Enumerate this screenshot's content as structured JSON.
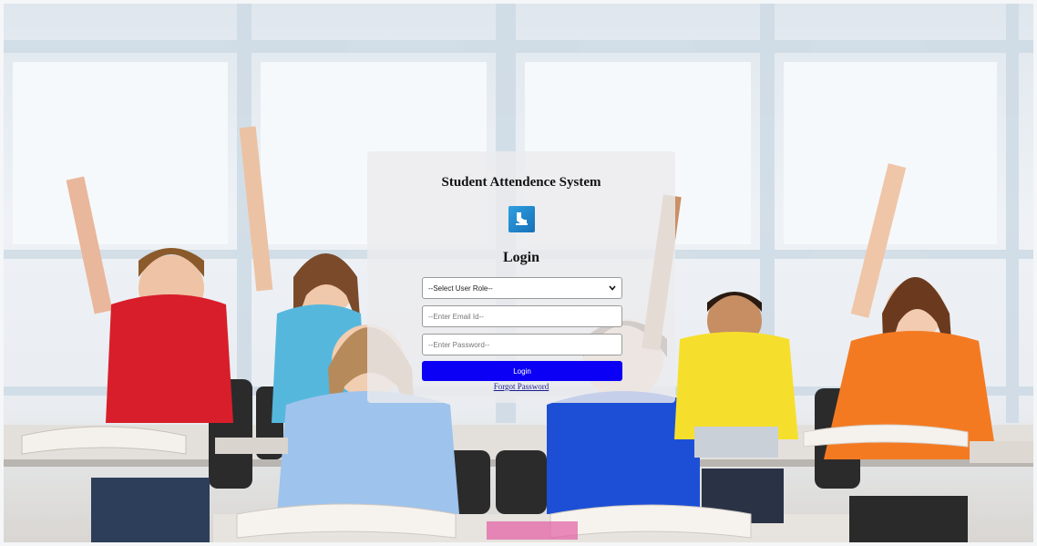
{
  "app": {
    "title": "Student Attendence System"
  },
  "login": {
    "heading": "Login",
    "role_select": {
      "selected": "--Select User Role--"
    },
    "email": {
      "placeholder": "--Enter Email Id--"
    },
    "password": {
      "placeholder": "--Enter Password--"
    },
    "submit_label": "Login",
    "forgot_label": "Forgot Password"
  },
  "icons": {
    "logo": "attendance-logo-icon",
    "chevron": "chevron-down-icon"
  },
  "colors": {
    "primary_button": "#0b00f5",
    "logo": "#2a8fd6",
    "link": "#1a1a8f"
  }
}
